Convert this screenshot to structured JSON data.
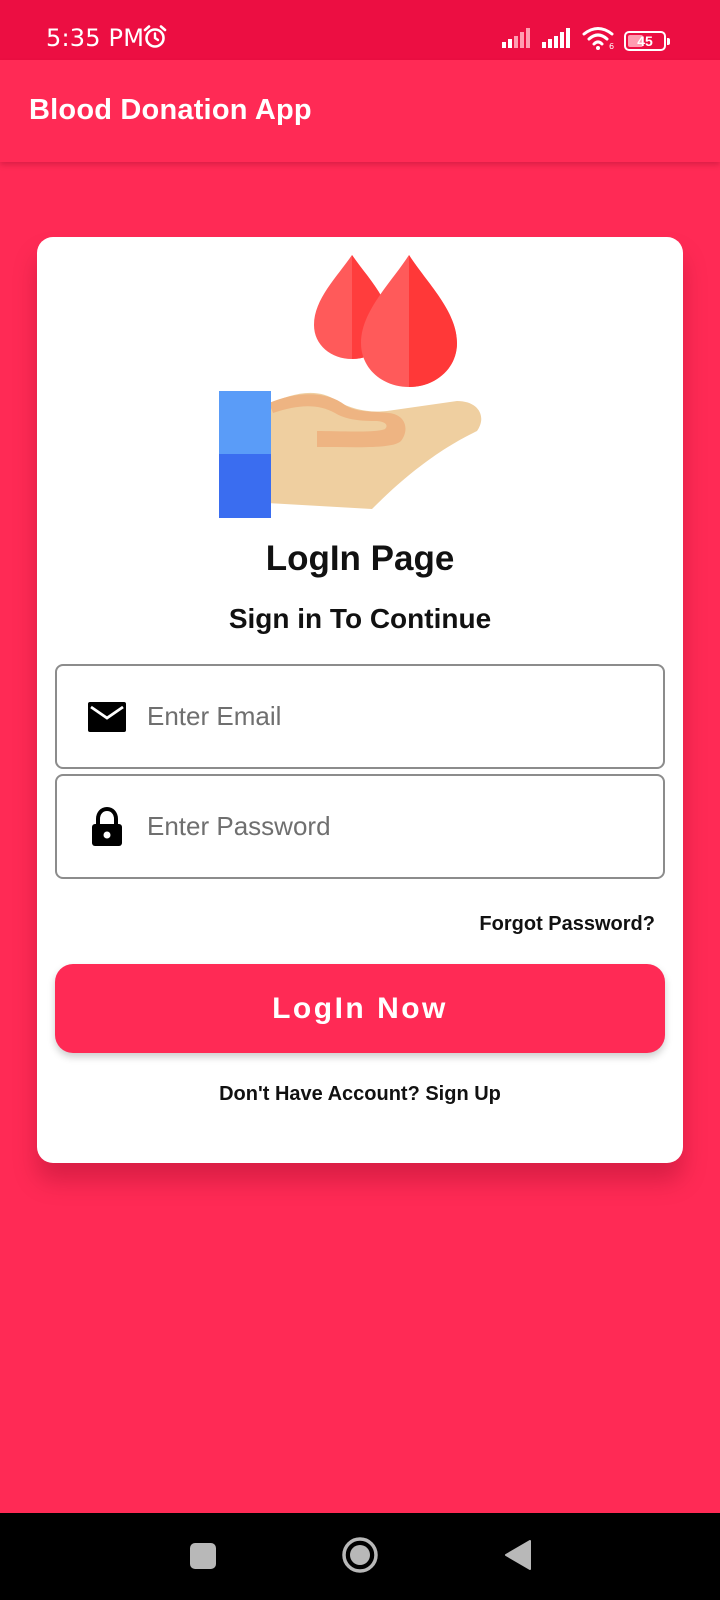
{
  "status_bar": {
    "time": "5:35 PM",
    "battery": "45",
    "icons": [
      "alarm-icon",
      "signal-icon",
      "signal-icon",
      "wifi-icon",
      "battery-icon"
    ]
  },
  "app_bar": {
    "title": "Blood Donation App"
  },
  "login": {
    "illustration": "blood-donation-hand-icon",
    "title": "LogIn Page",
    "subtitle": "Sign in To Continue",
    "email": {
      "value": "",
      "placeholder": "Enter Email",
      "icon": "email-icon"
    },
    "password": {
      "value": "",
      "placeholder": "Enter Password",
      "icon": "lock-icon"
    },
    "forgot_label": "Forgot Password?",
    "login_label": "LogIn Now",
    "signup_label": "Don't Have Account? Sign Up"
  },
  "nav_bar": {
    "icons": [
      "recent-apps-icon",
      "home-icon",
      "back-icon"
    ]
  },
  "colors": {
    "primary": "#FF2A55",
    "status_bar": "#EC0E42",
    "card": "#FFFFFF"
  }
}
